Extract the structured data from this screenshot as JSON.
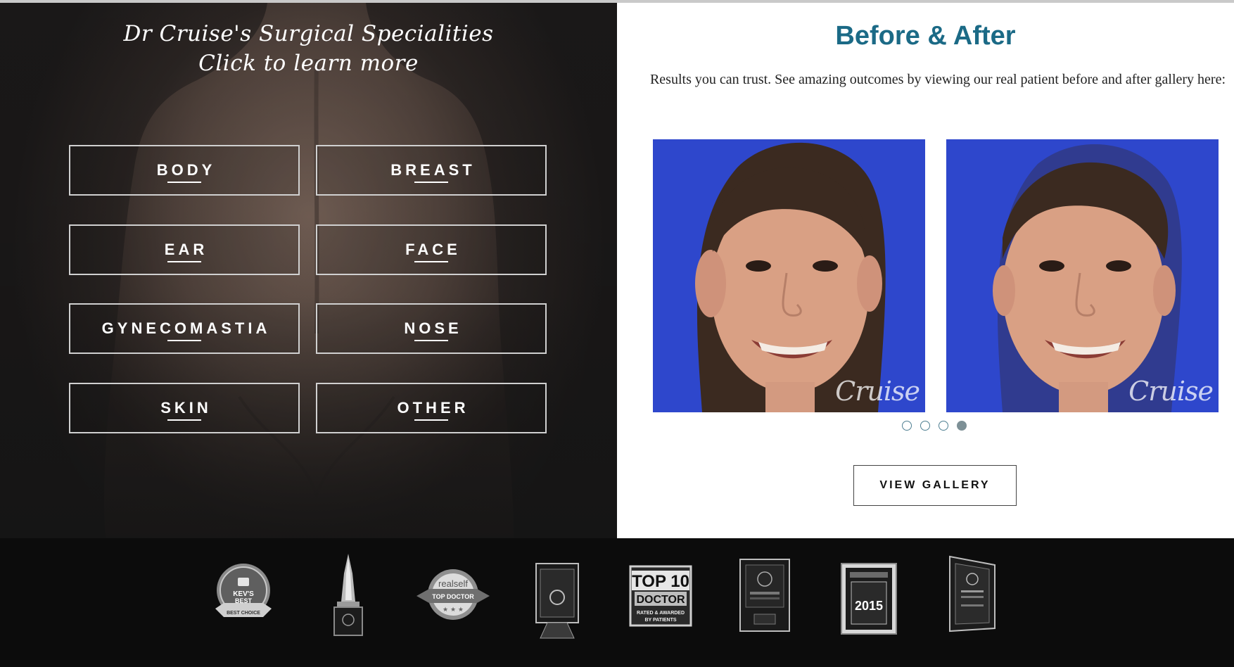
{
  "specialities": {
    "title_line1": "Dr Cruise's Surgical Specialities",
    "title_line2": "Click to learn more",
    "buttons": [
      {
        "label": "BODY"
      },
      {
        "label": "BREAST"
      },
      {
        "label": "EAR"
      },
      {
        "label": "FACE"
      },
      {
        "label": "GYNECOMASTIA"
      },
      {
        "label": "NOSE"
      },
      {
        "label": "SKIN"
      },
      {
        "label": "OTHER"
      }
    ]
  },
  "before_after": {
    "title": "Before & After",
    "description": "Results you can trust. See amazing outcomes by viewing our real patient before and after gallery here:",
    "watermark": "Cruise",
    "carousel": {
      "count": 4,
      "active_index": 3
    },
    "button_label": "VIEW GALLERY",
    "title_color": "#1b6a86",
    "photo_background": "#2c44c9"
  },
  "awards": {
    "items": [
      {
        "icon": "kevs-best-badge-icon",
        "lines": [
          "KEV'S",
          "BEST",
          "BEST CHOICE"
        ]
      },
      {
        "icon": "crystal-trophy-icon",
        "lines": []
      },
      {
        "icon": "realself-top-doctor-badge-icon",
        "lines": [
          "realself",
          "TOP DOCTOR"
        ]
      },
      {
        "icon": "plaque-award-icon",
        "lines": []
      },
      {
        "icon": "top10-doctor-badge-icon",
        "lines": [
          "TOP 10",
          "DOCTOR",
          "RATED & AWARDED",
          "BY PATIENTS"
        ]
      },
      {
        "icon": "framed-award-icon",
        "lines": []
      },
      {
        "icon": "2015-award-plaque-icon",
        "lines": [
          "2015"
        ]
      },
      {
        "icon": "americas-top-physicians-plaque-icon",
        "lines": []
      }
    ]
  }
}
